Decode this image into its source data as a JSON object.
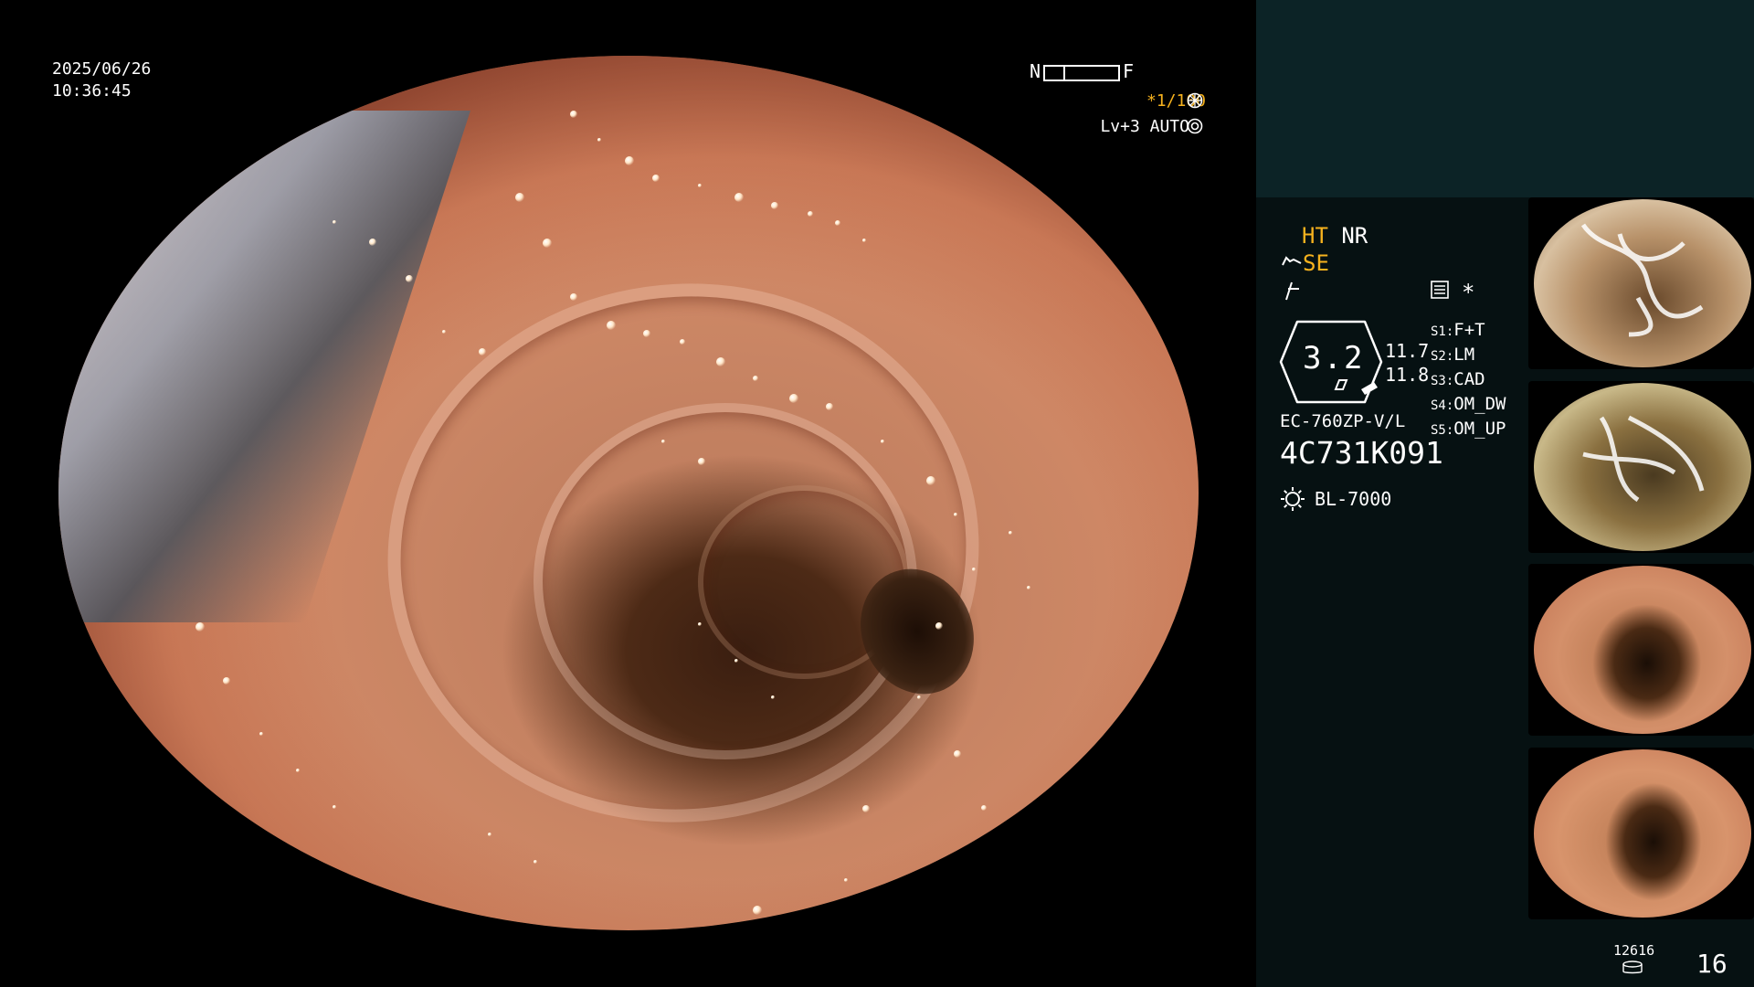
{
  "header": {
    "date": "2025/06/26",
    "time": "10:36:45"
  },
  "overlay": {
    "scale_near": "N",
    "scale_far": "F",
    "shutter": "*1/100",
    "level": "Lv+3 AUTO"
  },
  "panel": {
    "mode_ht": "HT",
    "mode_nr": "NR",
    "mode_se": "SE",
    "star": "*",
    "zoom_value": "3.2",
    "readout_1": "11.7",
    "readout_2": "11.8",
    "switches": [
      {
        "key": "S1:",
        "value": "F+T"
      },
      {
        "key": "S2:",
        "value": "LM"
      },
      {
        "key": "S3:",
        "value": "CAD"
      },
      {
        "key": "S4:",
        "value": "OM_DW"
      },
      {
        "key": "S5:",
        "value": "OM_UP"
      }
    ],
    "scope_model": "EC-760ZP-V/L",
    "scope_serial": "4C731K091",
    "light_source": "BL-7000"
  },
  "footer": {
    "storage_count": "12616",
    "image_count": "16"
  },
  "colors": {
    "accent": "#f6b21e",
    "panel_top": "#0c2326",
    "panel_bottom": "#061112"
  }
}
